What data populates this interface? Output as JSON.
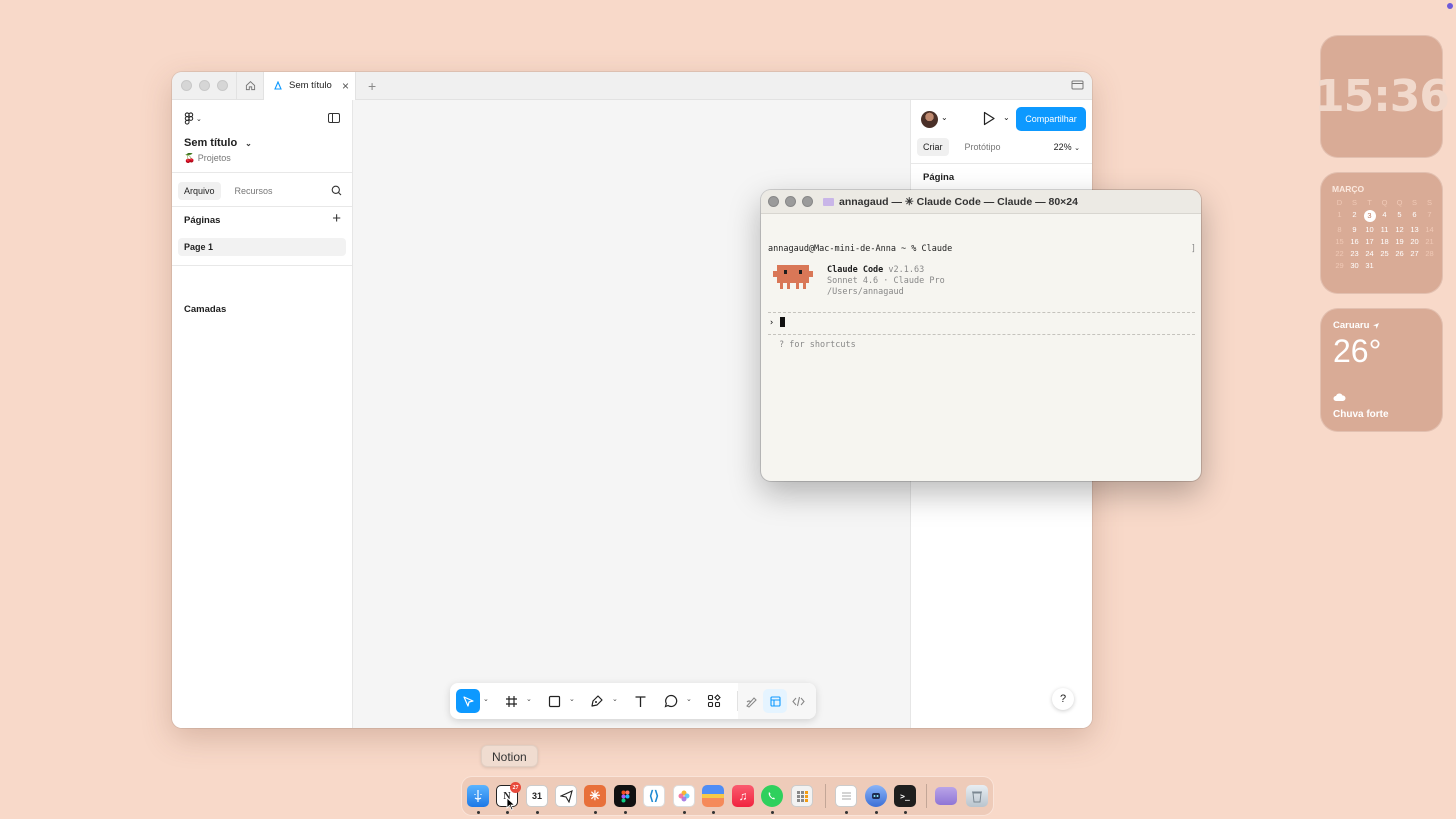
{
  "figma": {
    "tab_title": "Sem título",
    "file_name": "Sem título",
    "project": "🍒 Projetos",
    "left_tabs": [
      "Arquivo",
      "Recursos"
    ],
    "pages_label": "Páginas",
    "page_item": "Page 1",
    "layers_label": "Camadas",
    "share_label": "Compartilhar",
    "right_tabs": [
      "Criar",
      "Protótipo"
    ],
    "zoom": "22%",
    "page_section": "Página",
    "help": "?"
  },
  "terminal": {
    "title": "annagaud — ✳ Claude Code — Claude — 80×24",
    "command": "annagaud@Mac-mini-de-Anna ~ % Claude",
    "app_name": "Claude Code",
    "version": "v2.1.63",
    "model": "Sonnet 4.6 · Claude Pro",
    "cwd": "/Users/annagaud",
    "prompt": "›",
    "hint": "? for shortcuts"
  },
  "widgets": {
    "clock": "15:36",
    "calendar": {
      "month": "MARÇO",
      "weekdays": [
        "D",
        "S",
        "T",
        "Q",
        "Q",
        "S",
        "S"
      ],
      "today": "3"
    },
    "weather": {
      "city": "Caruaru",
      "temp": "26°",
      "condition": "Chuva forte"
    }
  },
  "dock": {
    "tooltip": "Notion",
    "notion_badge": "27",
    "calendar_date": "31",
    "apps": [
      "finder-icon",
      "notion-icon",
      "calendar-icon",
      "telegram-icon",
      "claude-icon",
      "figma-icon",
      "vscode-icon",
      "photos-icon",
      "arc-icon",
      "music-icon",
      "whatsapp-icon",
      "calculator-icon",
      "notes-icon",
      "ai-assistant-icon",
      "terminal-icon",
      "downloads-folder-icon",
      "trash-icon"
    ]
  },
  "colors": {
    "desktop": "#f8d9c9",
    "figma_blue": "#0d99ff",
    "widget": "#d9ab96"
  }
}
